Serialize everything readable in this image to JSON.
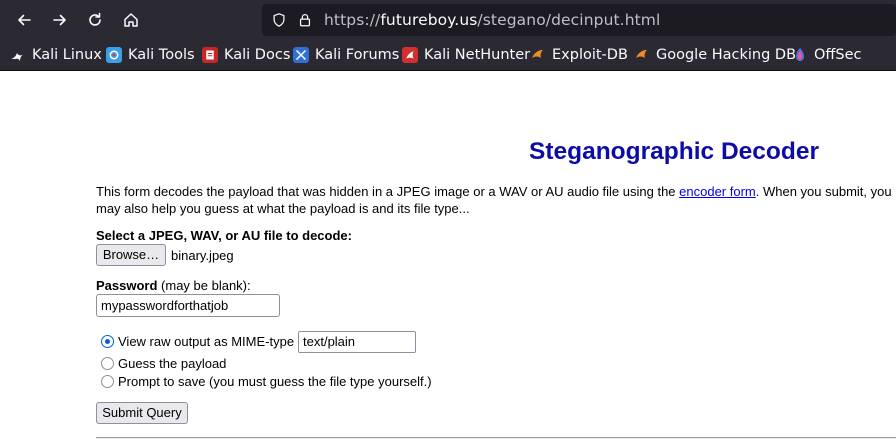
{
  "browser": {
    "url_prefix": "https://",
    "url_host": "futureboy.us",
    "url_path": "/stegano/decinput.html"
  },
  "bookmarks": [
    {
      "label": "Kali Linux",
      "icon": "kali-dragon-icon"
    },
    {
      "label": "Kali Tools",
      "icon": "kali-tools-icon"
    },
    {
      "label": "Kali Docs",
      "icon": "kali-docs-icon"
    },
    {
      "label": "Kali Forums",
      "icon": "kali-forums-icon"
    },
    {
      "label": "Kali NetHunter",
      "icon": "kali-nethunter-icon"
    },
    {
      "label": "Exploit-DB",
      "icon": "exploit-db-icon"
    },
    {
      "label": "Google Hacking DB",
      "icon": "ghdb-icon"
    },
    {
      "label": "OffSec",
      "icon": "offsec-icon"
    }
  ],
  "page": {
    "title": "Steganographic Decoder",
    "intro_line1_before": "This form decodes the payload that was hidden in a JPEG image or a WAV or AU audio file using the ",
    "intro_link": "encoder form",
    "intro_line1_after": ". When you submit, you",
    "intro_line2": "may also help you guess at what the payload is and its file type...",
    "file_label": "Select a JPEG, WAV, or AU file to decode:",
    "browse_label": "Browse…",
    "file_name": "binary.jpeg",
    "password_label_bold": "Password",
    "password_label_rest": " (may be blank):",
    "password_value": "mypasswordforthatjob",
    "options": [
      {
        "label": "View raw output as MIME-type",
        "checked": true
      },
      {
        "label": "Guess the payload",
        "checked": false
      },
      {
        "label": "Prompt to save (you must guess the file type yourself.)",
        "checked": false
      }
    ],
    "mime_value": "text/plain",
    "submit_label": "Submit Query"
  }
}
